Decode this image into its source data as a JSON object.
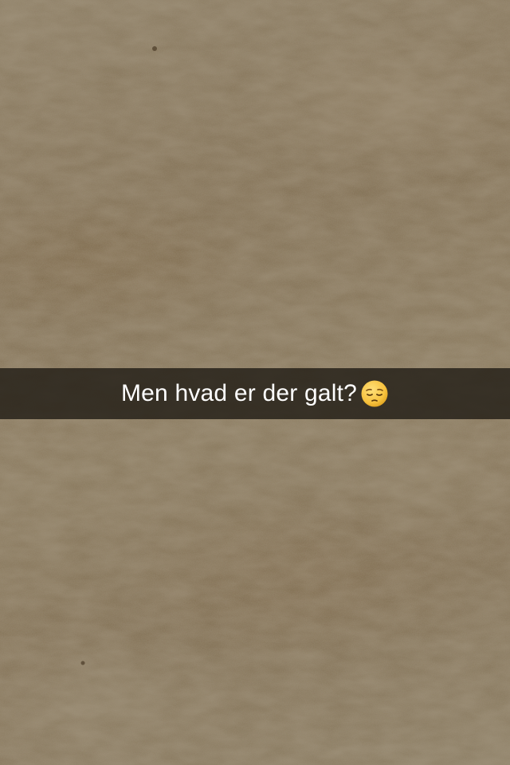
{
  "caption": {
    "text": "Men hvad er der galt?",
    "emoji": "pensive-face-icon"
  },
  "colors": {
    "fabric_base": "#857353",
    "caption_bar": "#1c1812",
    "caption_text": "#ffffff",
    "emoji_face": "#f7c23e"
  }
}
